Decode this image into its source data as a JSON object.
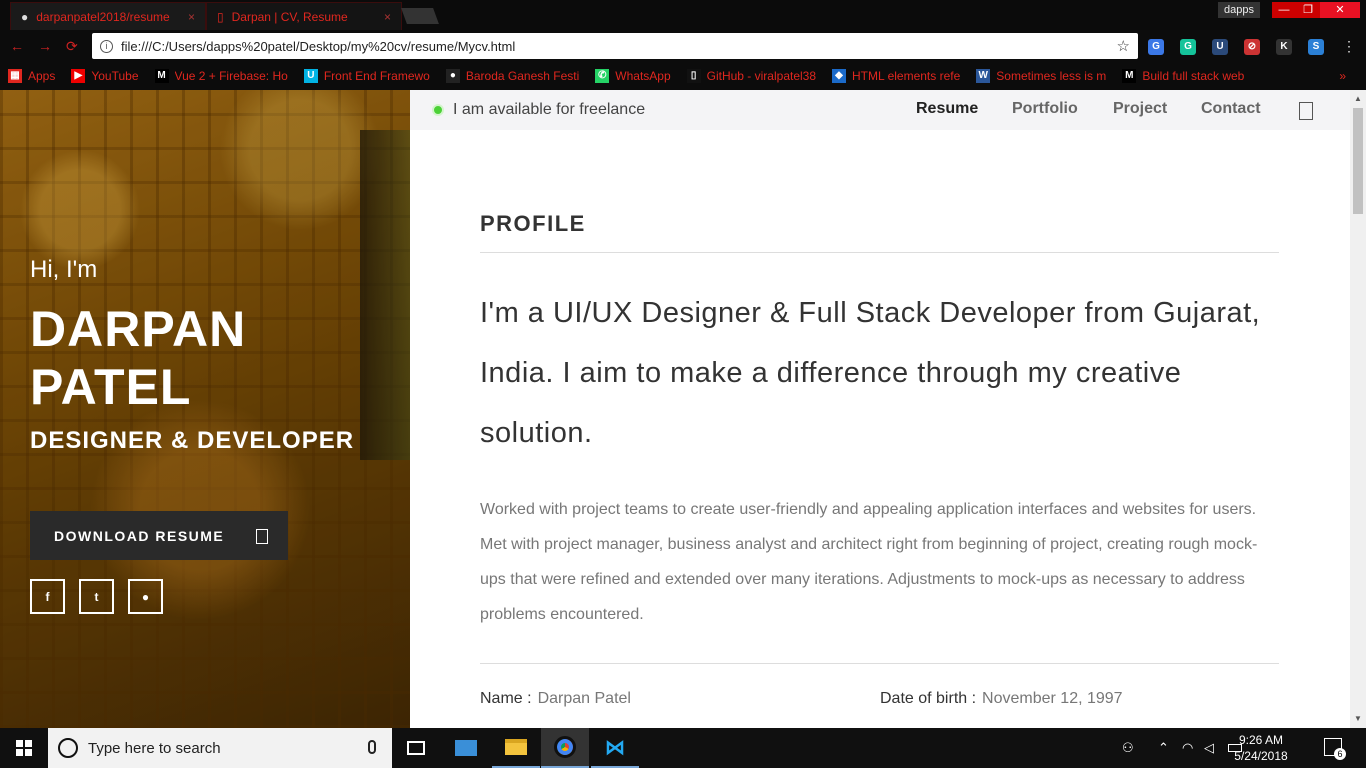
{
  "browser": {
    "tabs": [
      {
        "title": "darpanpatel2018/resume",
        "close": "×"
      },
      {
        "title": "Darpan | CV, Resume",
        "close": "×"
      }
    ],
    "profile_name": "dapps",
    "window_controls": {
      "minimize": "—",
      "restore": "❐",
      "close": "✕"
    },
    "nav": {
      "back": "←",
      "forward": "→",
      "reload": "⟳"
    },
    "url": "file:///C:/Users/dapps%20patel/Desktop/my%20cv/resume/Mycv.html",
    "star": "☆",
    "extensions": [
      {
        "icon": "translate-icon",
        "label": "G",
        "color": "#3b78e7"
      },
      {
        "icon": "grammarly-icon",
        "label": "G",
        "color": "#15c39a"
      },
      {
        "icon": "unsplash-icon",
        "label": "U",
        "color": "#2b4a7a"
      },
      {
        "icon": "block-icon",
        "label": "⊘",
        "color": "#c33"
      },
      {
        "icon": "k-icon",
        "label": "K",
        "color": "#333"
      },
      {
        "icon": "s-icon",
        "label": "S",
        "color": "#2b80d6"
      }
    ],
    "menu": "⋮",
    "bookmarks": [
      {
        "icon": "apps-icon",
        "glyph": "▦",
        "label": "Apps",
        "color": "#e0271f"
      },
      {
        "icon": "youtube-icon",
        "glyph": "▶",
        "label": "YouTube",
        "color": "#e00"
      },
      {
        "icon": "medium-icon",
        "glyph": "M",
        "label": "Vue 2 + Firebase: Ho",
        "color": "#000"
      },
      {
        "icon": "udacity-icon",
        "glyph": "U",
        "label": "Front End Framewo",
        "color": "#02b3e4"
      },
      {
        "icon": "globe-icon",
        "glyph": "●",
        "label": "Baroda Ganesh Festi",
        "color": "#222"
      },
      {
        "icon": "whatsapp-icon",
        "glyph": "✆",
        "label": "WhatsApp",
        "color": "#25d366"
      },
      {
        "icon": "page-icon",
        "glyph": "▯",
        "label": "GitHub - viralpatel38",
        "color": "#111"
      },
      {
        "icon": "html-icon",
        "glyph": "◆",
        "label": "HTML elements refe",
        "color": "#1b6ac9"
      },
      {
        "icon": "word-icon",
        "glyph": "W",
        "label": "Sometimes less is m",
        "color": "#2b579a"
      },
      {
        "icon": "medium-icon-2",
        "glyph": "M",
        "label": "Build full stack web",
        "color": "#000"
      }
    ],
    "bookmarks_more": "»"
  },
  "hero": {
    "greeting": "Hi, I'm",
    "name": "DARPAN PATEL",
    "role": "DESIGNER & DEVELOPER",
    "download_label": "DOWNLOAD RESUME",
    "socials": [
      {
        "icon": "facebook-icon",
        "glyph": "f"
      },
      {
        "icon": "twitter-icon",
        "glyph": "t"
      },
      {
        "icon": "github-icon",
        "glyph": "●"
      }
    ]
  },
  "topbar": {
    "freelance": "I am available for freelance",
    "status_color": "#4cd137",
    "nav": [
      "Resume",
      "Portfolio",
      "Project",
      "Contact"
    ],
    "active_nav": "Resume"
  },
  "profile": {
    "title": "PROFILE",
    "lead": "I'm a UI/UX Designer & Full Stack Developer from Gujarat, India. I aim to make a difference through my creative solution.",
    "body": "Worked with project teams to create user-friendly and appealing application interfaces and websites for users. Met with project manager, business analyst and architect right from beginning of project, creating rough mock-ups that were refined and extended over many iterations. Adjustments to mock-ups as necessary to address problems encountered.",
    "fields": [
      {
        "label": "Name :",
        "value": "Darpan Patel"
      },
      {
        "label": "Date of birth :",
        "value": "November 12, 1997"
      }
    ]
  },
  "taskbar": {
    "search_placeholder": "Type here to search",
    "time": "9:26 AM",
    "date": "5/24/2018",
    "notification_count": "6"
  }
}
